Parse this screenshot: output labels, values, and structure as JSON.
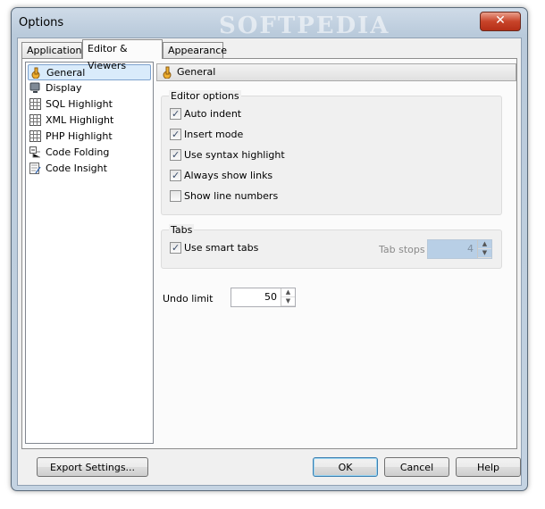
{
  "window": {
    "title": "Options",
    "watermark": "SOFTPEDIA",
    "close_glyph": "✕"
  },
  "tabs": [
    {
      "label": "Application"
    },
    {
      "label": "Editor & Viewers",
      "active": true
    },
    {
      "label": "Appearance"
    }
  ],
  "tree": {
    "items": [
      {
        "label": "General",
        "icon": "hand-icon",
        "selected": true
      },
      {
        "label": "Display",
        "icon": "monitor-icon"
      },
      {
        "label": "SQL Highlight",
        "icon": "grid-icon"
      },
      {
        "label": "XML Highlight",
        "icon": "grid-icon"
      },
      {
        "label": "PHP Highlight",
        "icon": "grid-icon"
      },
      {
        "label": "Code Folding",
        "icon": "folding-icon"
      },
      {
        "label": "Code Insight",
        "icon": "insight-icon"
      }
    ]
  },
  "section_header": {
    "label": "General",
    "icon": "hand-icon"
  },
  "editor_options": {
    "label": "Editor options",
    "items": [
      {
        "label": "Auto indent",
        "checked": true
      },
      {
        "label": "Insert mode",
        "checked": true
      },
      {
        "label": "Use syntax highlight",
        "checked": true
      },
      {
        "label": "Always show links",
        "checked": true
      },
      {
        "label": "Show line numbers",
        "checked": false
      }
    ]
  },
  "tabs_group": {
    "label": "Tabs",
    "smart_tabs": {
      "label": "Use smart tabs",
      "checked": true
    },
    "tab_stops": {
      "label": "Tab stops",
      "value": "4",
      "enabled": false
    }
  },
  "undo": {
    "label": "Undo limit",
    "value": "50"
  },
  "buttons": {
    "export": "Export Settings...",
    "ok": "OK",
    "cancel": "Cancel",
    "help": "Help"
  },
  "colors": {
    "accent": "#3c7fb1",
    "selection": "#d9ebfb",
    "disabled_field": "#b8cfe6"
  }
}
